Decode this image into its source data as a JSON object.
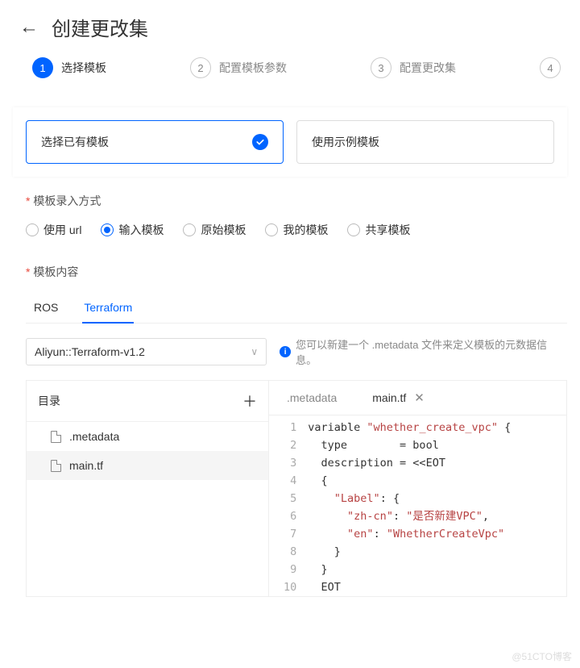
{
  "header": {
    "title": "创建更改集"
  },
  "steps": [
    {
      "num": "1",
      "label": "选择模板",
      "active": true
    },
    {
      "num": "2",
      "label": "配置模板参数",
      "active": false
    },
    {
      "num": "3",
      "label": "配置更改集",
      "active": false
    },
    {
      "num": "4",
      "label": "",
      "active": false
    }
  ],
  "choices": {
    "existing": "选择已有模板",
    "sample": "使用示例模板"
  },
  "inputMethod": {
    "label": "模板录入方式",
    "options": {
      "url": "使用 url",
      "input": "输入模板",
      "raw": "原始模板",
      "mine": "我的模板",
      "shared": "共享模板"
    }
  },
  "content": {
    "label": "模板内容",
    "tabs": {
      "ros": "ROS",
      "terraform": "Terraform"
    },
    "version": "Aliyun::Terraform-v1.2",
    "hint": "您可以新建一个 .metadata 文件来定义模板的元数据信息。"
  },
  "directory": {
    "label": "目录",
    "files": {
      "metadata": ".metadata",
      "main": "main.tf"
    }
  },
  "fileTabs": {
    "metadata": ".metadata",
    "main": "main.tf"
  },
  "code": {
    "nums": [
      "1",
      "2",
      "3",
      "4",
      "5",
      "6",
      "7",
      "8",
      "9",
      "10"
    ],
    "l1a": "variable ",
    "l1b": "\"whether_create_vpc\"",
    "l1c": " {",
    "l2": "  type        = bool",
    "l3": "  description = <<EOT",
    "l4": "  {",
    "l5a": "    ",
    "l5b": "\"Label\"",
    "l5c": ": {",
    "l6a": "      ",
    "l6b": "\"zh-cn\"",
    "l6c": ": ",
    "l6d": "\"是否新建VPC\"",
    "l6e": ",",
    "l7a": "      ",
    "l7b": "\"en\"",
    "l7c": ": ",
    "l7d": "\"WhetherCreateVpc\"",
    "l8": "    }",
    "l9": "  }",
    "l10": "  EOT"
  },
  "watermark": "@51CTO博客"
}
